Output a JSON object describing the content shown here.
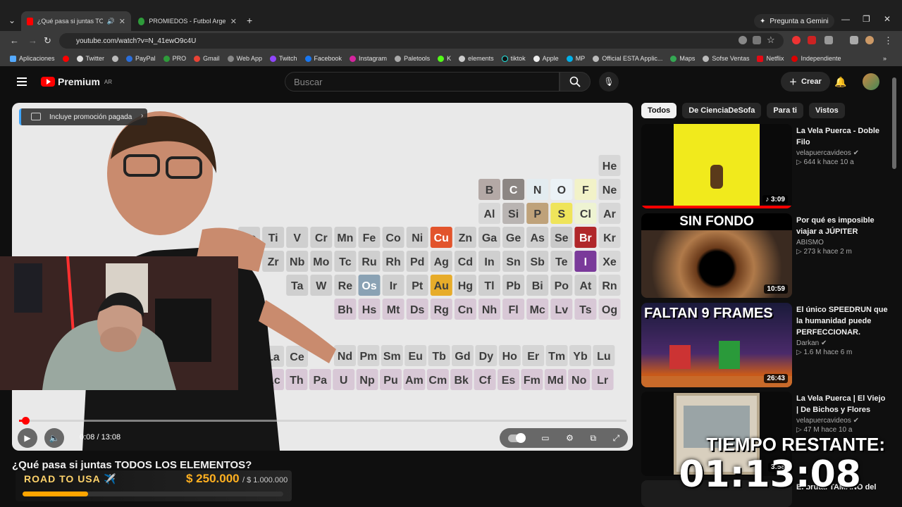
{
  "browser": {
    "tabs": [
      {
        "title": "¿Qué pasa si juntas TODOS",
        "active": true
      },
      {
        "title": "PROMIEDOS - Futbol Argentino",
        "active": false
      }
    ],
    "new_tab": "+",
    "gemini": "Pregunta a Gemini",
    "url": "youtube.com/watch?v=N_41ewO9c4U",
    "bookmarks": [
      "Aplicaciones",
      "Twitter",
      "PayPal",
      "PRO",
      "Gmail",
      "Web App",
      "Twitch",
      "Facebook",
      "Instagram",
      "Paletools",
      "K",
      "elements",
      "tiktok",
      "Apple",
      "MP",
      "Official ESTA Applic...",
      "Maps",
      "Sofse Ventas",
      "Netflix",
      "Independiente"
    ]
  },
  "youtube": {
    "logo": "Premium",
    "region": "AR",
    "search_placeholder": "Buscar",
    "create": "Crear"
  },
  "player": {
    "promo": "Incluye promoción pagada",
    "time": "0:08 / 13:08",
    "progress": 0.01,
    "title": "¿Qué pasa si juntas TODOS LOS ELEMENTOS?"
  },
  "periodic_table": {
    "cells": [
      {
        "s": "He",
        "c": "#d7d7d7"
      },
      {
        "s": "B",
        "c": "#b4a9a6"
      },
      {
        "s": "C",
        "c": "#8c8683"
      },
      {
        "s": "N",
        "c": "#e3ecf0"
      },
      {
        "s": "O",
        "c": "#ebf2f6"
      },
      {
        "s": "F",
        "c": "#f2f2c8"
      },
      {
        "s": "Ne",
        "c": "#d7d7d7"
      },
      {
        "s": "Al",
        "c": "#d8d8d8"
      },
      {
        "s": "Si",
        "c": "#b9b4b2"
      },
      {
        "s": "P",
        "c": "#bfa27a"
      },
      {
        "s": "S",
        "c": "#efe45a"
      },
      {
        "s": "Cl",
        "c": "#eef3d2"
      },
      {
        "s": "Ar",
        "c": "#d7d7d7"
      },
      {
        "s": "Sc",
        "c": "#cfcfcf"
      },
      {
        "s": "Ti",
        "c": "#cfcfcf"
      },
      {
        "s": "V",
        "c": "#cfcfcf"
      },
      {
        "s": "Cr",
        "c": "#cfcfcf"
      },
      {
        "s": "Mn",
        "c": "#cfcfcf"
      },
      {
        "s": "Fe",
        "c": "#cfcfcf"
      },
      {
        "s": "Co",
        "c": "#cfcfcf"
      },
      {
        "s": "Ni",
        "c": "#cfcfcf"
      },
      {
        "s": "Cu",
        "c": "#e2542c"
      },
      {
        "s": "Zn",
        "c": "#cfcfcf"
      },
      {
        "s": "Ga",
        "c": "#cfcfcf"
      },
      {
        "s": "Ge",
        "c": "#cfcfcf"
      },
      {
        "s": "As",
        "c": "#cfcfcf"
      },
      {
        "s": "Se",
        "c": "#c9c9c9"
      },
      {
        "s": "Br",
        "c": "#b0272a"
      },
      {
        "s": "Kr",
        "c": "#d7d7d7"
      },
      {
        "s": "Zr",
        "c": "#cfcfcf"
      },
      {
        "s": "Nb",
        "c": "#cfcfcf"
      },
      {
        "s": "Mo",
        "c": "#cfcfcf"
      },
      {
        "s": "Tc",
        "c": "#cfcfcf"
      },
      {
        "s": "Ru",
        "c": "#cfcfcf"
      },
      {
        "s": "Rh",
        "c": "#cfcfcf"
      },
      {
        "s": "Pd",
        "c": "#cfcfcf"
      },
      {
        "s": "Ag",
        "c": "#cfcfcf"
      },
      {
        "s": "Cd",
        "c": "#cfcfcf"
      },
      {
        "s": "In",
        "c": "#cfcfcf"
      },
      {
        "s": "Sn",
        "c": "#cfcfcf"
      },
      {
        "s": "Sb",
        "c": "#cfcfcf"
      },
      {
        "s": "Te",
        "c": "#cfcfcf"
      },
      {
        "s": "I",
        "c": "#7a3a9a"
      },
      {
        "s": "Xe",
        "c": "#d7d7d7"
      },
      {
        "s": "Ta",
        "c": "#cfcfcf"
      },
      {
        "s": "W",
        "c": "#cfcfcf"
      },
      {
        "s": "Re",
        "c": "#cfcfcf"
      },
      {
        "s": "Os",
        "c": "#8aa2b4"
      },
      {
        "s": "Ir",
        "c": "#cfcfcf"
      },
      {
        "s": "Pt",
        "c": "#cfcfcf"
      },
      {
        "s": "Au",
        "c": "#e7ac2a"
      },
      {
        "s": "Hg",
        "c": "#cfcfcf"
      },
      {
        "s": "Tl",
        "c": "#cfcfcf"
      },
      {
        "s": "Pb",
        "c": "#cfcfcf"
      },
      {
        "s": "Bi",
        "c": "#cfcfcf"
      },
      {
        "s": "Po",
        "c": "#cfcfcf"
      },
      {
        "s": "At",
        "c": "#cfcfcf"
      },
      {
        "s": "Rn",
        "c": "#d7d7d7"
      },
      {
        "s": "Bh",
        "c": "#d8c8d6"
      },
      {
        "s": "Hs",
        "c": "#d8c8d6"
      },
      {
        "s": "Mt",
        "c": "#d8c8d6"
      },
      {
        "s": "Ds",
        "c": "#d8c8d6"
      },
      {
        "s": "Rg",
        "c": "#d8c8d6"
      },
      {
        "s": "Cn",
        "c": "#d8c8d6"
      },
      {
        "s": "Nh",
        "c": "#d8c8d6"
      },
      {
        "s": "Fl",
        "c": "#d8c8d6"
      },
      {
        "s": "Mc",
        "c": "#d8c8d6"
      },
      {
        "s": "Lv",
        "c": "#d8c8d6"
      },
      {
        "s": "Ts",
        "c": "#d8c8d6"
      },
      {
        "s": "Og",
        "c": "#ddd2db"
      },
      {
        "s": "La",
        "c": "#d5d5d5"
      },
      {
        "s": "Ce",
        "c": "#d5d5d5"
      },
      {
        "s": "Nd",
        "c": "#d5d5d5"
      },
      {
        "s": "Pm",
        "c": "#d5d5d5"
      },
      {
        "s": "Sm",
        "c": "#d5d5d5"
      },
      {
        "s": "Eu",
        "c": "#d5d5d5"
      },
      {
        "s": "Tb",
        "c": "#d5d5d5"
      },
      {
        "s": "Gd",
        "c": "#d5d5d5"
      },
      {
        "s": "Dy",
        "c": "#d5d5d5"
      },
      {
        "s": "Ho",
        "c": "#d5d5d5"
      },
      {
        "s": "Er",
        "c": "#d5d5d5"
      },
      {
        "s": "Tm",
        "c": "#d5d5d5"
      },
      {
        "s": "Yb",
        "c": "#d5d5d5"
      },
      {
        "s": "Lu",
        "c": "#d5d5d5"
      },
      {
        "s": "Ac",
        "c": "#d8c8d6"
      },
      {
        "s": "Th",
        "c": "#d8c8d6"
      },
      {
        "s": "Pa",
        "c": "#d8c8d6"
      },
      {
        "s": "U",
        "c": "#d8c8d6"
      },
      {
        "s": "Np",
        "c": "#d8c8d6"
      },
      {
        "s": "Pu",
        "c": "#d8c8d6"
      },
      {
        "s": "Am",
        "c": "#d8c8d6"
      },
      {
        "s": "Cm",
        "c": "#d8c8d6"
      },
      {
        "s": "Bk",
        "c": "#d8c8d6"
      },
      {
        "s": "Cf",
        "c": "#d8c8d6"
      },
      {
        "s": "Es",
        "c": "#d8c8d6"
      },
      {
        "s": "Fm",
        "c": "#d8c8d6"
      },
      {
        "s": "Md",
        "c": "#d8c8d6"
      },
      {
        "s": "No",
        "c": "#d8c8d6"
      },
      {
        "s": "Lr",
        "c": "#d8c8d6"
      }
    ]
  },
  "overlay": {
    "road_label": "ROAD TO USA ✈️",
    "amount": "$ 250.000",
    "goal": "/ $ 1.000.000",
    "goal_progress": 0.25,
    "timer_label": "TIEMPO RESTANTE:",
    "timer_value": "01:13:08"
  },
  "sidebar": {
    "chips": [
      "Todos",
      "De CienciaDeSofa",
      "Para ti",
      "Vistos"
    ],
    "videos": [
      {
        "title": "La Vela Puerca - Doble Filo",
        "channel": "velapuercavideos",
        "meta": "▷ 644 k  hace 10 a",
        "duration": "♪ 3:09",
        "thumb": "#f1ea1c"
      },
      {
        "title": "Por qué es imposible viajar a JÚPITER",
        "channel": "ABISMO",
        "meta": "▷ 273 k  hace 2 m",
        "duration": "10:59",
        "thumb": "#8a5a2a",
        "thumb_text": "SIN FONDO"
      },
      {
        "title": "El único SPEEDRUN que la humanidad puede PERFECCIONAR.",
        "channel": "Darkan",
        "meta": "▷ 1.6 M  hace 6 m",
        "duration": "26:43",
        "thumb": "#3a3a8a",
        "thumb_text": "FALTAN 9 FRAMES"
      },
      {
        "title": "La Vela Puerca | El Viejo | De Bichos y Flores",
        "channel": "velapuercavideos",
        "meta": "▷ 47 M  hace 10 a",
        "duration": "3:58",
        "thumb": "#c9b79a"
      },
      {
        "title": "El brutal TAMAÑO del",
        "channel": "",
        "meta": "",
        "duration": "",
        "thumb": "#222"
      }
    ]
  }
}
